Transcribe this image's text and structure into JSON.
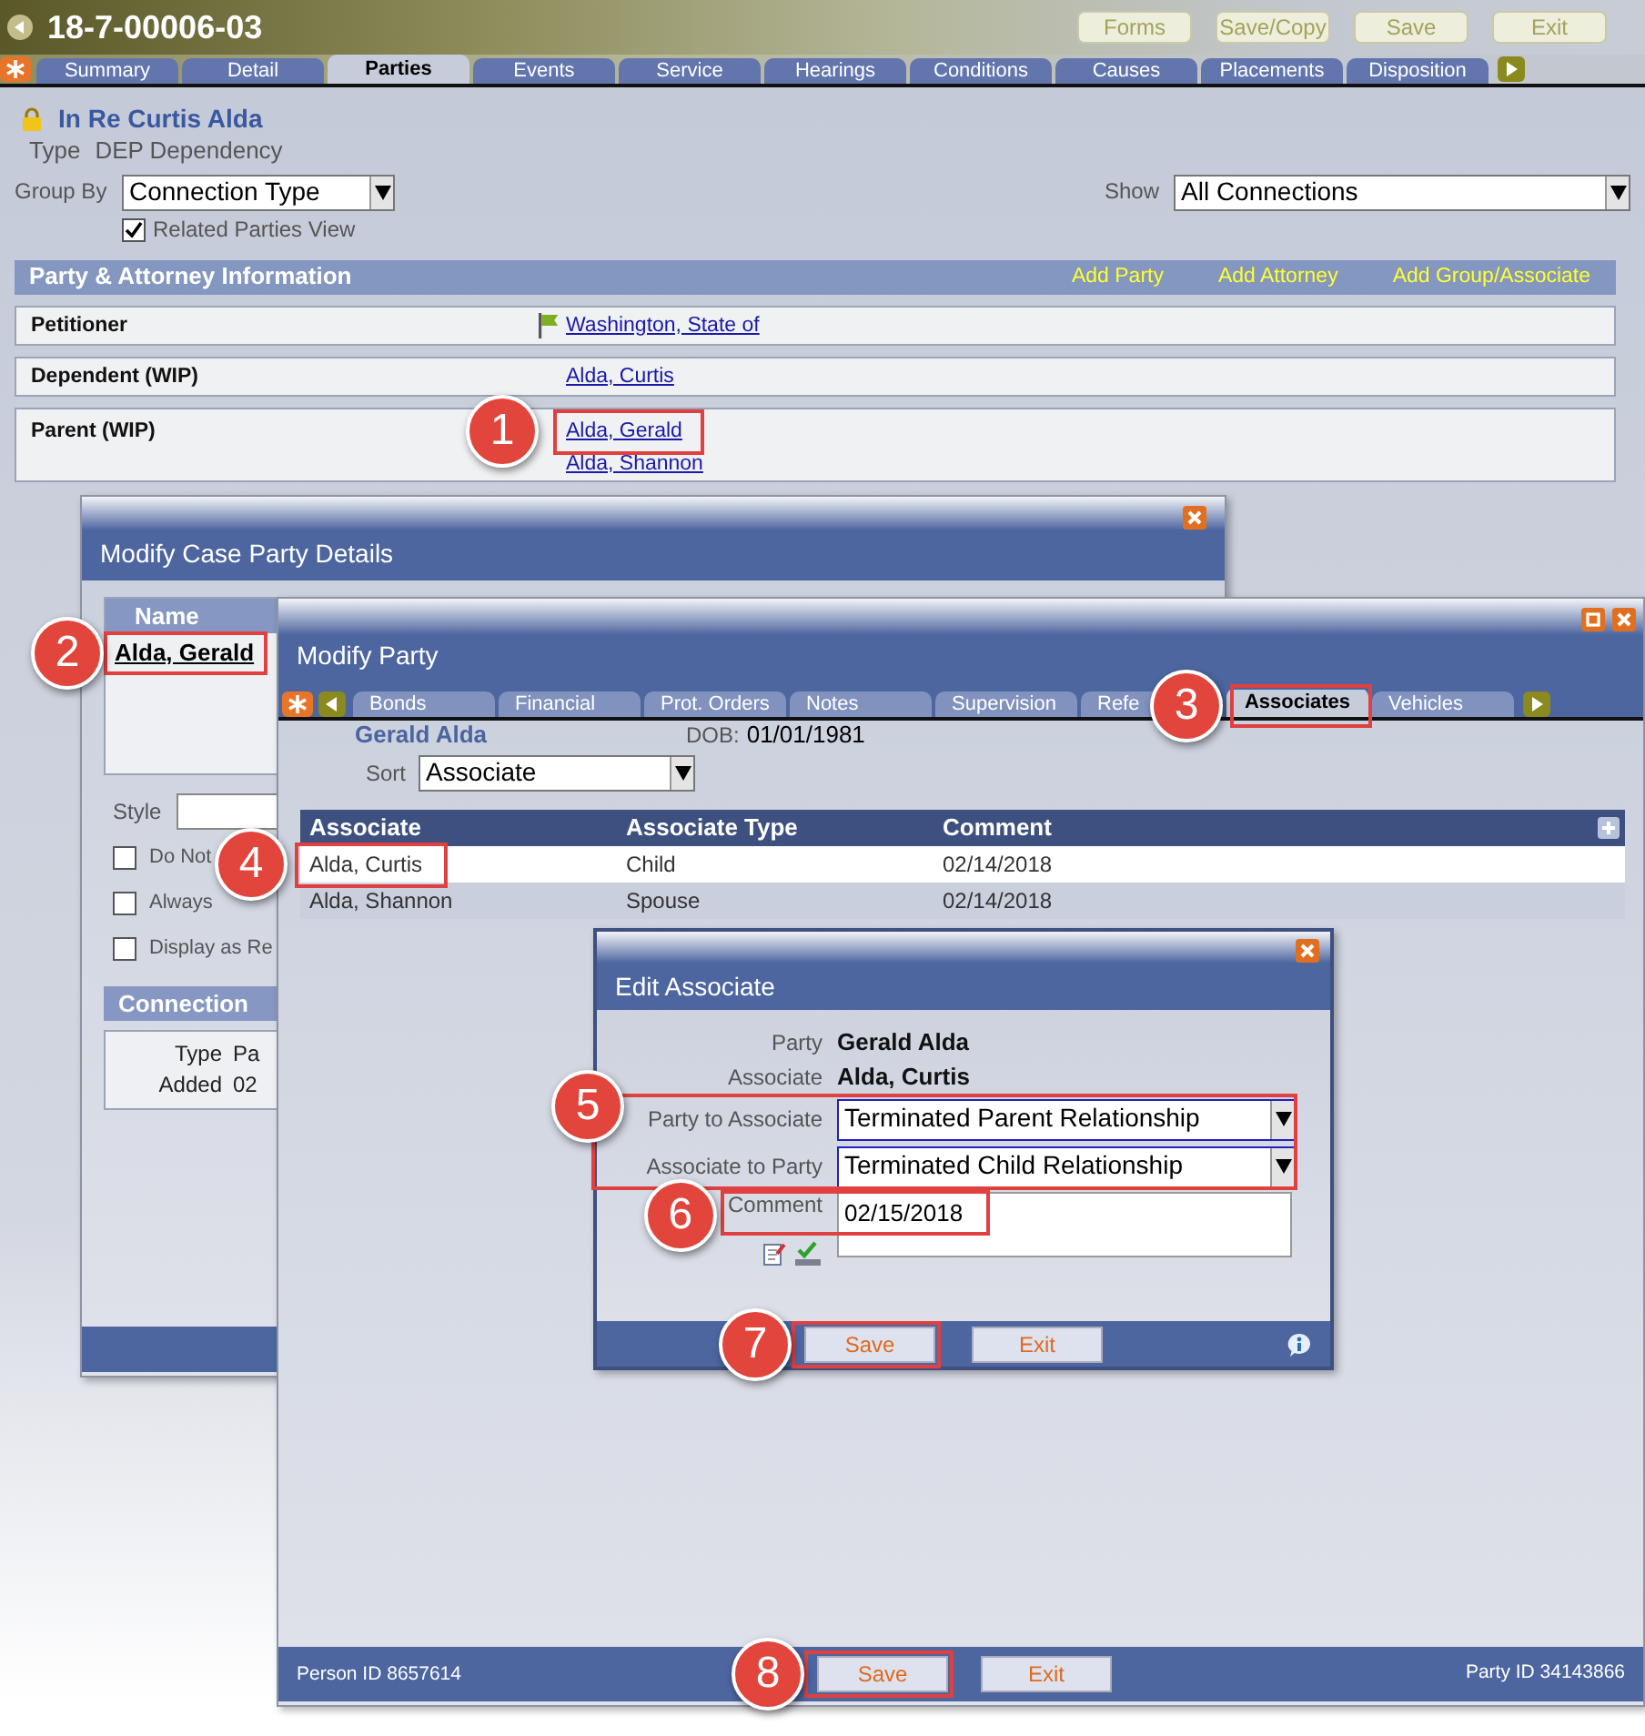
{
  "case_header": {
    "case_number": "18-7-00006-03",
    "buttons": [
      "Forms",
      "Save/Copy",
      "Save",
      "Exit"
    ]
  },
  "tabs": [
    {
      "label": "Summary",
      "selected": false
    },
    {
      "label": "Detail",
      "selected": false
    },
    {
      "label": "Parties",
      "selected": true
    },
    {
      "label": "Events",
      "selected": false
    },
    {
      "label": "Service",
      "selected": false
    },
    {
      "label": "Hearings",
      "selected": false
    },
    {
      "label": "Conditions",
      "selected": false
    },
    {
      "label": "Causes",
      "selected": false
    },
    {
      "label": "Placements",
      "selected": false
    },
    {
      "label": "Disposition",
      "selected": false
    }
  ],
  "case": {
    "title": "In Re Curtis Alda",
    "type_label": "Type",
    "type_value": "DEP Dependency"
  },
  "group_by": {
    "label": "Group By",
    "value": "Connection Type"
  },
  "show": {
    "label": "Show",
    "value": "All Connections"
  },
  "related_parties_view": {
    "label": "Related Parties View",
    "checked": true
  },
  "party_section": {
    "title": "Party & Attorney Information",
    "actions": [
      "Add Party",
      "Add Attorney",
      "Add Group/Associate"
    ],
    "rows": [
      {
        "role": "Petitioner",
        "flagged": true,
        "parties": [
          "Washington, State of"
        ]
      },
      {
        "role": "Dependent (WIP)",
        "flagged": false,
        "parties": [
          "Alda, Curtis"
        ]
      },
      {
        "role": "Parent (WIP)",
        "flagged": false,
        "parties": [
          "Alda, Gerald",
          "Alda, Shannon"
        ]
      }
    ]
  },
  "case_party_dialog": {
    "title": "Modify Case Party Details",
    "name_header": "Name",
    "name": "Alda, Gerald",
    "style_label": "Style",
    "options": [
      {
        "label": "Do Not",
        "checked": false
      },
      {
        "label": "Always",
        "checked": false
      },
      {
        "label": "Display as Re",
        "checked": false
      }
    ],
    "connection_header": "Connection",
    "connection_fields": [
      {
        "label": "Type",
        "value": "Pa"
      },
      {
        "label": "Added",
        "value": "02"
      }
    ]
  },
  "party_dialog": {
    "title": "Modify Party",
    "tabs": [
      {
        "label": "Bonds",
        "selected": false
      },
      {
        "label": "Financial",
        "selected": false
      },
      {
        "label": "Prot. Orders",
        "selected": false
      },
      {
        "label": "Notes",
        "selected": false
      },
      {
        "label": "Supervision",
        "selected": false
      },
      {
        "label": "Refe",
        "selected": false
      },
      {
        "label": "Associates",
        "selected": true
      },
      {
        "label": "Vehicles",
        "selected": false
      }
    ],
    "party_name": "Gerald Alda",
    "dob_label": "DOB:",
    "dob": "01/01/1981",
    "sort_label": "Sort",
    "sort_value": "Associate",
    "columns": [
      "Associate",
      "Associate Type",
      "Comment"
    ],
    "rows": [
      {
        "cells": [
          "Alda, Curtis",
          "Child",
          "02/14/2018"
        ],
        "selected": true
      },
      {
        "cells": [
          "Alda, Shannon",
          "Spouse",
          "02/14/2018"
        ],
        "selected": false
      }
    ],
    "footer": {
      "person_id": "Person ID 8657614",
      "buttons": [
        "Save",
        "Exit"
      ],
      "party_id": "Party ID 34143866"
    }
  },
  "associate_dialog": {
    "title": "Edit Associate",
    "fields": [
      {
        "kind": "text",
        "label": "Party",
        "value": "Gerald Alda"
      },
      {
        "kind": "text",
        "label": "Associate",
        "value": "Alda, Curtis"
      },
      {
        "kind": "select",
        "label": "Party to Associate",
        "value": "Terminated Parent Relationship"
      },
      {
        "kind": "select",
        "label": "Associate to Party",
        "value": "Terminated Child Relationship"
      },
      {
        "kind": "textarea",
        "label": "Comment",
        "value": "02/15/2018"
      }
    ],
    "buttons": [
      "Save",
      "Exit"
    ]
  },
  "callouts": [
    "1",
    "2",
    "3",
    "4",
    "5",
    "6",
    "7",
    "8"
  ]
}
